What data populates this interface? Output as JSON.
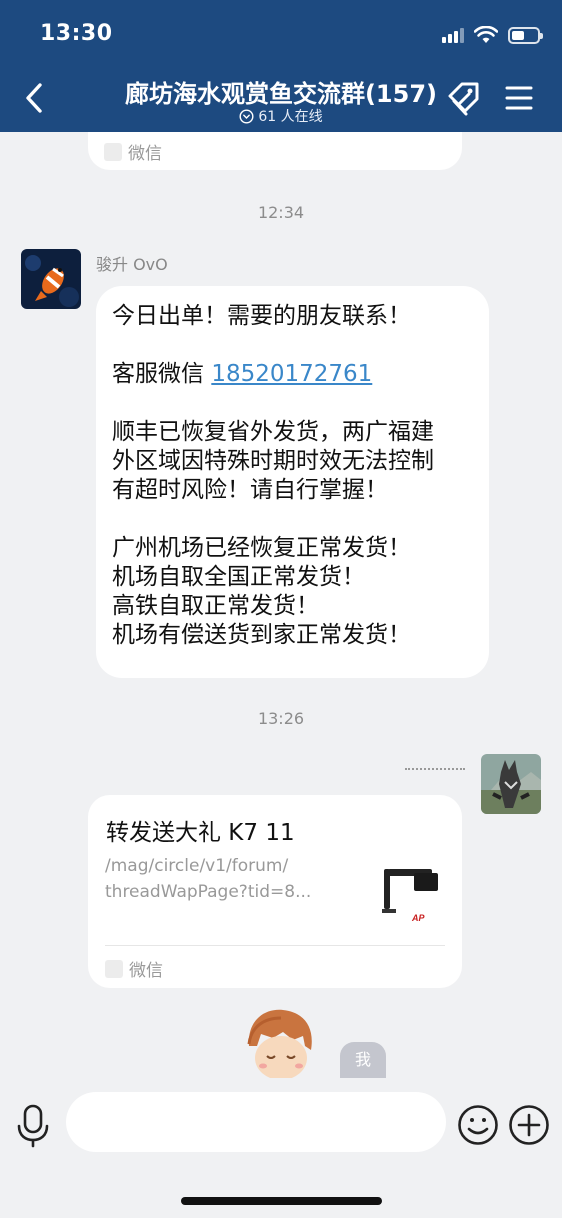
{
  "status_bar": {
    "time": "13:30"
  },
  "header": {
    "title": "廊坊海水观赏鱼交流群(157)",
    "online": "61 人在线"
  },
  "messages": {
    "top_card": {
      "source": "微信"
    },
    "time1": "12:34",
    "msg1": {
      "sender": "骏升 OvO",
      "line1": "今日出单！需要的朋友联系！",
      "line2_prefix": "客服微信 ",
      "line2_link": "18520172761",
      "para3": "顺丰已恢复省外发货，两广福建\n外区域因特殊时期时效无法控制\n有超时风险！请自行掌握！",
      "para4": "广州机场已经恢复正常发货！\n机场自取全国正常发货！\n高铁自取正常发货！\n机场有偿送货到家正常发货！"
    },
    "time2": "13:26",
    "share_card": {
      "title": "转发送大礼 K7 11",
      "url": "/mag/circle/v1/forum/\nthreadWapPage?tid=8...",
      "source": "微信",
      "thumb_label": "AP"
    },
    "me_badge": "我"
  },
  "colors": {
    "header_bg": "#1d4a80",
    "chat_bg": "#f0f1f3",
    "link": "#3a87c9"
  }
}
